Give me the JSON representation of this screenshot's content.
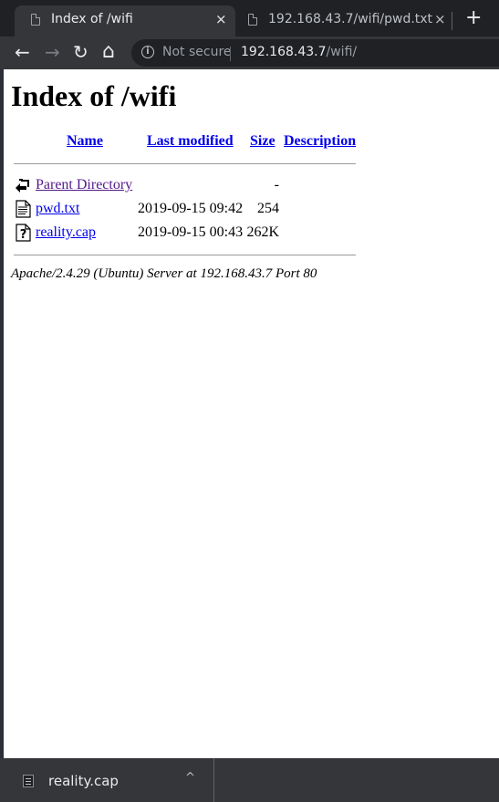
{
  "browser": {
    "tabs": [
      {
        "title": "Index of /wifi",
        "close": "×",
        "active": true
      },
      {
        "title": "192.168.43.7/wifi/pwd.txt",
        "close": "×",
        "active": false
      }
    ],
    "new_tab": "+",
    "nav": {
      "back": "←",
      "forward": "→",
      "reload": "↻",
      "home": "⌂"
    },
    "address_bar": {
      "security_text": "Not secure",
      "host": "192.168.43.7",
      "path": "/wifi/"
    }
  },
  "page": {
    "title": "Index of /wifi",
    "columns": {
      "name": "Name",
      "last_modified": "Last modified",
      "size": "Size",
      "description": "Description"
    },
    "parent": {
      "name": "Parent Directory",
      "size": "-",
      "icon": "back-folder-icon"
    },
    "files": [
      {
        "name": "pwd.txt",
        "modified": "2019-09-15 09:42",
        "size": "254",
        "icon": "text-file-icon"
      },
      {
        "name": "reality.cap",
        "modified": "2019-09-15 00:43",
        "size": "262K",
        "icon": "unknown-file-icon"
      }
    ],
    "server_signature": "Apache/2.4.29 (Ubuntu) Server at 192.168.43.7 Port 80"
  },
  "downloads": {
    "items": [
      {
        "filename": "reality.cap",
        "icon": "file-icon"
      }
    ],
    "chevron": "^"
  }
}
